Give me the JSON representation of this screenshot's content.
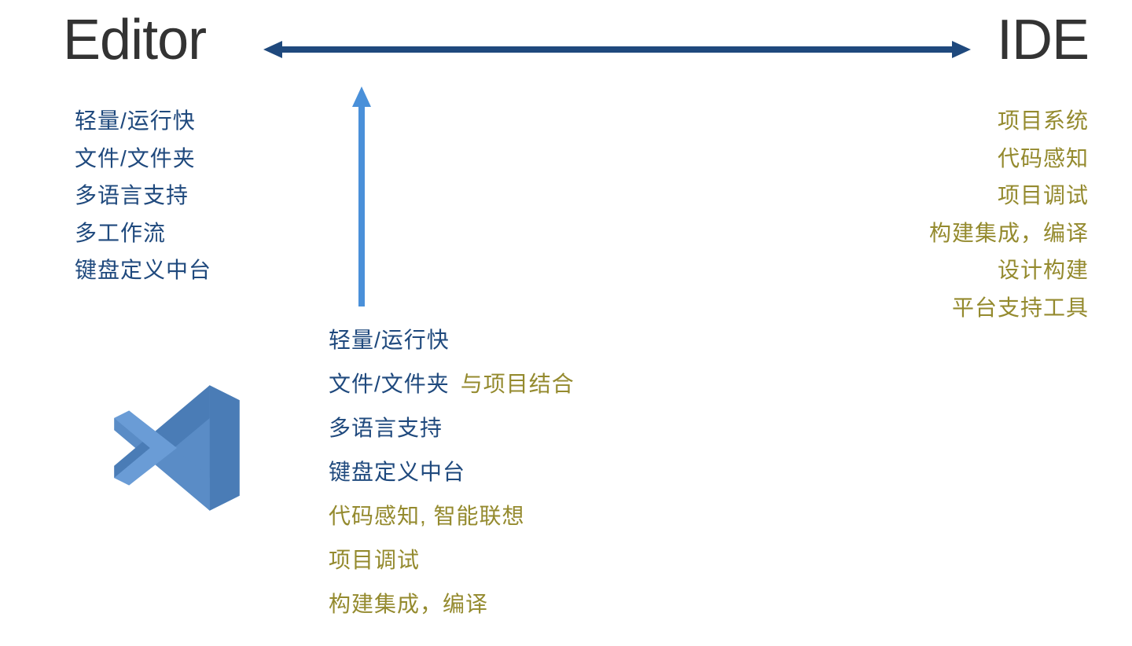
{
  "titles": {
    "left": "Editor",
    "right": "IDE"
  },
  "editor_list": [
    "轻量/运行快",
    "文件/文件夹",
    "多语言支持",
    "多工作流",
    "键盘定义中台"
  ],
  "ide_list": [
    "项目系统",
    "代码感知",
    "项目调试",
    "构建集成，编译",
    "设计构建",
    "平台支持工具"
  ],
  "middle_list": [
    {
      "blue": "轻量/运行快",
      "olive": ""
    },
    {
      "blue": "文件/文件夹",
      "olive": "与项目结合"
    },
    {
      "blue": "多语言支持",
      "olive": ""
    },
    {
      "blue": "键盘定义中台",
      "olive": ""
    },
    {
      "blue": "",
      "olive": "代码感知, 智能联想"
    },
    {
      "blue": "",
      "olive": "项目调试"
    },
    {
      "blue": "",
      "olive": "构建集成，编译"
    }
  ],
  "colors": {
    "editor_text": "#1f497d",
    "ide_text": "#948a2e",
    "h_arrow": "#1f497d",
    "v_arrow": "#4a90d9",
    "vscode_blue": "#4a7cb6"
  }
}
